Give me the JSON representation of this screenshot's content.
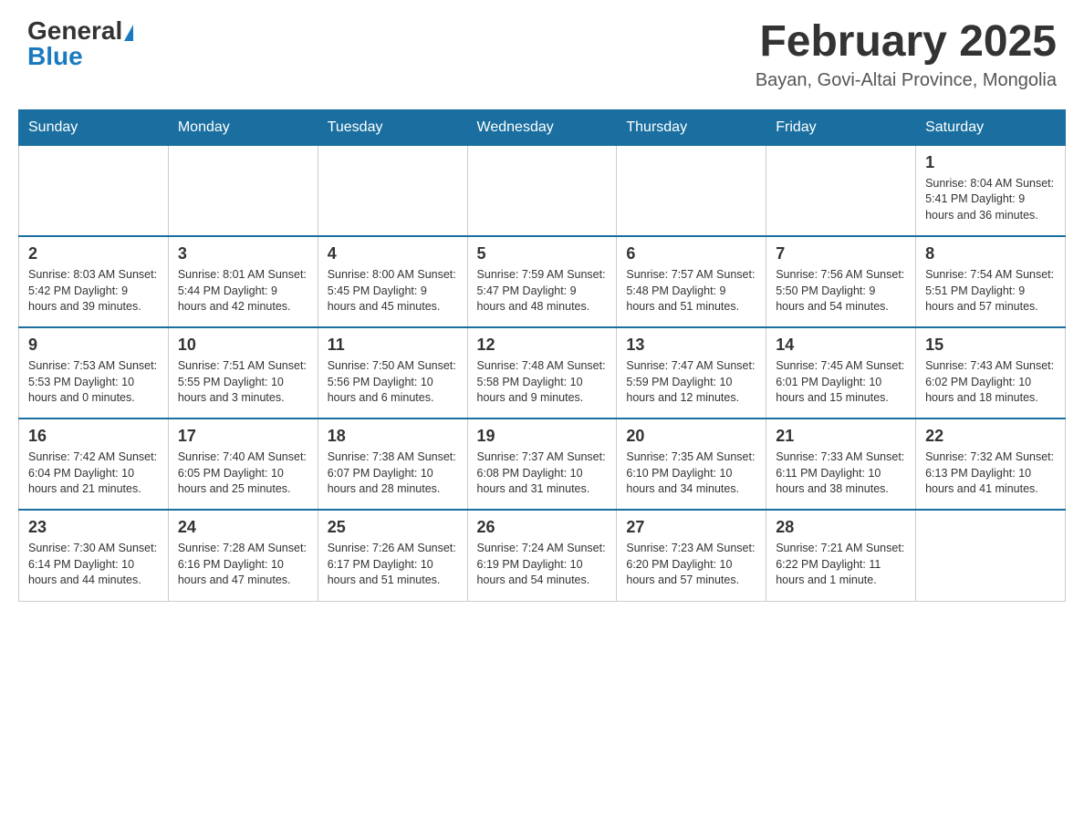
{
  "header": {
    "logo_general": "General",
    "logo_blue": "Blue",
    "month_title": "February 2025",
    "location": "Bayan, Govi-Altai Province, Mongolia"
  },
  "days_of_week": [
    "Sunday",
    "Monday",
    "Tuesday",
    "Wednesday",
    "Thursday",
    "Friday",
    "Saturday"
  ],
  "weeks": [
    [
      {
        "day": "",
        "info": ""
      },
      {
        "day": "",
        "info": ""
      },
      {
        "day": "",
        "info": ""
      },
      {
        "day": "",
        "info": ""
      },
      {
        "day": "",
        "info": ""
      },
      {
        "day": "",
        "info": ""
      },
      {
        "day": "1",
        "info": "Sunrise: 8:04 AM\nSunset: 5:41 PM\nDaylight: 9 hours and 36 minutes."
      }
    ],
    [
      {
        "day": "2",
        "info": "Sunrise: 8:03 AM\nSunset: 5:42 PM\nDaylight: 9 hours and 39 minutes."
      },
      {
        "day": "3",
        "info": "Sunrise: 8:01 AM\nSunset: 5:44 PM\nDaylight: 9 hours and 42 minutes."
      },
      {
        "day": "4",
        "info": "Sunrise: 8:00 AM\nSunset: 5:45 PM\nDaylight: 9 hours and 45 minutes."
      },
      {
        "day": "5",
        "info": "Sunrise: 7:59 AM\nSunset: 5:47 PM\nDaylight: 9 hours and 48 minutes."
      },
      {
        "day": "6",
        "info": "Sunrise: 7:57 AM\nSunset: 5:48 PM\nDaylight: 9 hours and 51 minutes."
      },
      {
        "day": "7",
        "info": "Sunrise: 7:56 AM\nSunset: 5:50 PM\nDaylight: 9 hours and 54 minutes."
      },
      {
        "day": "8",
        "info": "Sunrise: 7:54 AM\nSunset: 5:51 PM\nDaylight: 9 hours and 57 minutes."
      }
    ],
    [
      {
        "day": "9",
        "info": "Sunrise: 7:53 AM\nSunset: 5:53 PM\nDaylight: 10 hours and 0 minutes."
      },
      {
        "day": "10",
        "info": "Sunrise: 7:51 AM\nSunset: 5:55 PM\nDaylight: 10 hours and 3 minutes."
      },
      {
        "day": "11",
        "info": "Sunrise: 7:50 AM\nSunset: 5:56 PM\nDaylight: 10 hours and 6 minutes."
      },
      {
        "day": "12",
        "info": "Sunrise: 7:48 AM\nSunset: 5:58 PM\nDaylight: 10 hours and 9 minutes."
      },
      {
        "day": "13",
        "info": "Sunrise: 7:47 AM\nSunset: 5:59 PM\nDaylight: 10 hours and 12 minutes."
      },
      {
        "day": "14",
        "info": "Sunrise: 7:45 AM\nSunset: 6:01 PM\nDaylight: 10 hours and 15 minutes."
      },
      {
        "day": "15",
        "info": "Sunrise: 7:43 AM\nSunset: 6:02 PM\nDaylight: 10 hours and 18 minutes."
      }
    ],
    [
      {
        "day": "16",
        "info": "Sunrise: 7:42 AM\nSunset: 6:04 PM\nDaylight: 10 hours and 21 minutes."
      },
      {
        "day": "17",
        "info": "Sunrise: 7:40 AM\nSunset: 6:05 PM\nDaylight: 10 hours and 25 minutes."
      },
      {
        "day": "18",
        "info": "Sunrise: 7:38 AM\nSunset: 6:07 PM\nDaylight: 10 hours and 28 minutes."
      },
      {
        "day": "19",
        "info": "Sunrise: 7:37 AM\nSunset: 6:08 PM\nDaylight: 10 hours and 31 minutes."
      },
      {
        "day": "20",
        "info": "Sunrise: 7:35 AM\nSunset: 6:10 PM\nDaylight: 10 hours and 34 minutes."
      },
      {
        "day": "21",
        "info": "Sunrise: 7:33 AM\nSunset: 6:11 PM\nDaylight: 10 hours and 38 minutes."
      },
      {
        "day": "22",
        "info": "Sunrise: 7:32 AM\nSunset: 6:13 PM\nDaylight: 10 hours and 41 minutes."
      }
    ],
    [
      {
        "day": "23",
        "info": "Sunrise: 7:30 AM\nSunset: 6:14 PM\nDaylight: 10 hours and 44 minutes."
      },
      {
        "day": "24",
        "info": "Sunrise: 7:28 AM\nSunset: 6:16 PM\nDaylight: 10 hours and 47 minutes."
      },
      {
        "day": "25",
        "info": "Sunrise: 7:26 AM\nSunset: 6:17 PM\nDaylight: 10 hours and 51 minutes."
      },
      {
        "day": "26",
        "info": "Sunrise: 7:24 AM\nSunset: 6:19 PM\nDaylight: 10 hours and 54 minutes."
      },
      {
        "day": "27",
        "info": "Sunrise: 7:23 AM\nSunset: 6:20 PM\nDaylight: 10 hours and 57 minutes."
      },
      {
        "day": "28",
        "info": "Sunrise: 7:21 AM\nSunset: 6:22 PM\nDaylight: 11 hours and 1 minute."
      },
      {
        "day": "",
        "info": ""
      }
    ]
  ]
}
